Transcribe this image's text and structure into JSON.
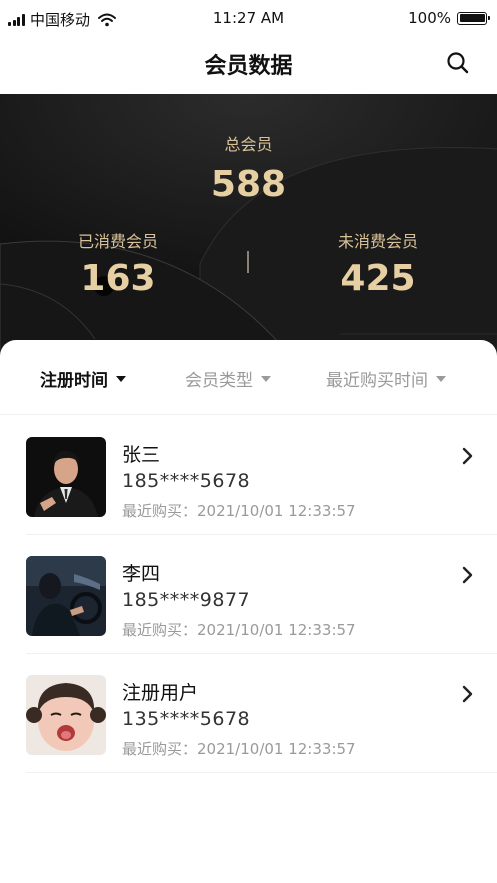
{
  "status_bar": {
    "carrier": "中国移动",
    "time": "11:27 AM",
    "battery": "100%"
  },
  "nav": {
    "title": "会员数据",
    "search_icon": "search-icon"
  },
  "stats": {
    "total_label": "总会员",
    "total_value": "588",
    "consumed_label": "已消费会员",
    "consumed_value": "163",
    "unconsumed_label": "未消费会员",
    "unconsumed_value": "425"
  },
  "filters": [
    {
      "label": "注册时间",
      "active": true
    },
    {
      "label": "会员类型",
      "active": false
    },
    {
      "label": "最近购买时间",
      "active": false
    }
  ],
  "members": [
    {
      "name": "张三",
      "phone": "185****5678",
      "recent": "最近购买：2021/10/01 12:33:57"
    },
    {
      "name": "李四",
      "phone": "185****9877",
      "recent": "最近购买：2021/10/01 12:33:57"
    },
    {
      "name": "注册用户",
      "phone": "135****5678",
      "recent": "最近购买：2021/10/01 12:33:57"
    }
  ],
  "colors": {
    "gold": "#e6cfa2",
    "banner_bg": "#111111"
  }
}
